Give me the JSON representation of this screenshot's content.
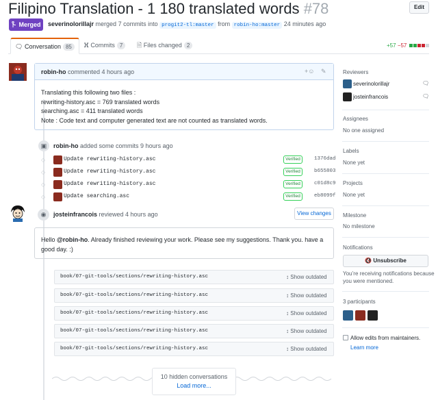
{
  "pr": {
    "title": "Filipino Translation - 1 180 translated words",
    "number": "#78",
    "edit_label": "Edit",
    "status_label": "Merged",
    "author": "severinolorillajr",
    "merged_text": "merged 7 commits into",
    "base_branch": "progit2-tl:master",
    "from_word": "from",
    "head_branch": "robin-ho:master",
    "time": "24 minutes ago"
  },
  "tabs": [
    {
      "label": "Conversation",
      "count": "85",
      "icon": "comment-icon"
    },
    {
      "label": "Commits",
      "count": "7",
      "icon": "commit-icon"
    },
    {
      "label": "Files changed",
      "count": "2",
      "icon": "file-diff-icon"
    }
  ],
  "diffstat": {
    "additions": "+57",
    "deletions": "−57"
  },
  "first_comment": {
    "author": "robin-ho",
    "action": "commented 4 hours ago",
    "lines": [
      "Translating this following two files :",
      "rewriting-history.asc = 769 translated words",
      "searching.asc = 411 translated words",
      "Note : Code text and computer generated text are not counted as translated words."
    ]
  },
  "commits_event": {
    "author": "robin-ho",
    "action": "added some commits 9 hours ago"
  },
  "commits": [
    {
      "message": "Update rewriting-history.asc",
      "badge": "Verified",
      "sha": "1376dad"
    },
    {
      "message": "Update rewriting-history.asc",
      "badge": "Verified",
      "sha": "b655803"
    },
    {
      "message": "Update rewriting-history.asc",
      "badge": "Verified",
      "sha": "c01d8c9"
    },
    {
      "message": "Update searching.asc",
      "badge": "Verified",
      "sha": "eb8099f"
    }
  ],
  "review": {
    "author": "josteinfrancois",
    "action": "reviewed 4 hours ago",
    "view_changes_label": "View changes",
    "body_prefix": "Hello ",
    "mention": "@robin-ho",
    "body_rest": ". Already finished reviewing your work. Please see my suggestions. Thank you. have a good day. :)"
  },
  "outdated_files": [
    {
      "path": "book/07-git-tools/sections/rewriting-history.asc",
      "label": "Show outdated"
    },
    {
      "path": "book/07-git-tools/sections/rewriting-history.asc",
      "label": "Show outdated"
    },
    {
      "path": "book/07-git-tools/sections/rewriting-history.asc",
      "label": "Show outdated"
    },
    {
      "path": "book/07-git-tools/sections/rewriting-history.asc",
      "label": "Show outdated"
    },
    {
      "path": "book/07-git-tools/sections/rewriting-history.asc",
      "label": "Show outdated"
    }
  ],
  "hidden": {
    "count_text": "10 hidden conversations",
    "load_more": "Load more..."
  },
  "sidebar": {
    "reviewers_label": "Reviewers",
    "reviewers": [
      "severinolorillajr",
      "josteinfrancois"
    ],
    "assignees_label": "Assignees",
    "assignees_value": "No one assigned",
    "labels_label": "Labels",
    "labels_value": "None yet",
    "projects_label": "Projects",
    "projects_value": "None yet",
    "milestone_label": "Milestone",
    "milestone_value": "No milestone",
    "notifications_label": "Notifications",
    "unsubscribe_label": "Unsubscribe",
    "notif_line1": "You’re receiving notifications because",
    "notif_line2": "you were mentioned.",
    "participants_label": "3 participants",
    "allow_edits_label": "Allow edits from maintainers.",
    "learn_more": "Learn more"
  },
  "colors": {
    "merged": "#6f42c1",
    "link": "#0366d6",
    "add": "#28a745",
    "del": "#cb2431"
  }
}
